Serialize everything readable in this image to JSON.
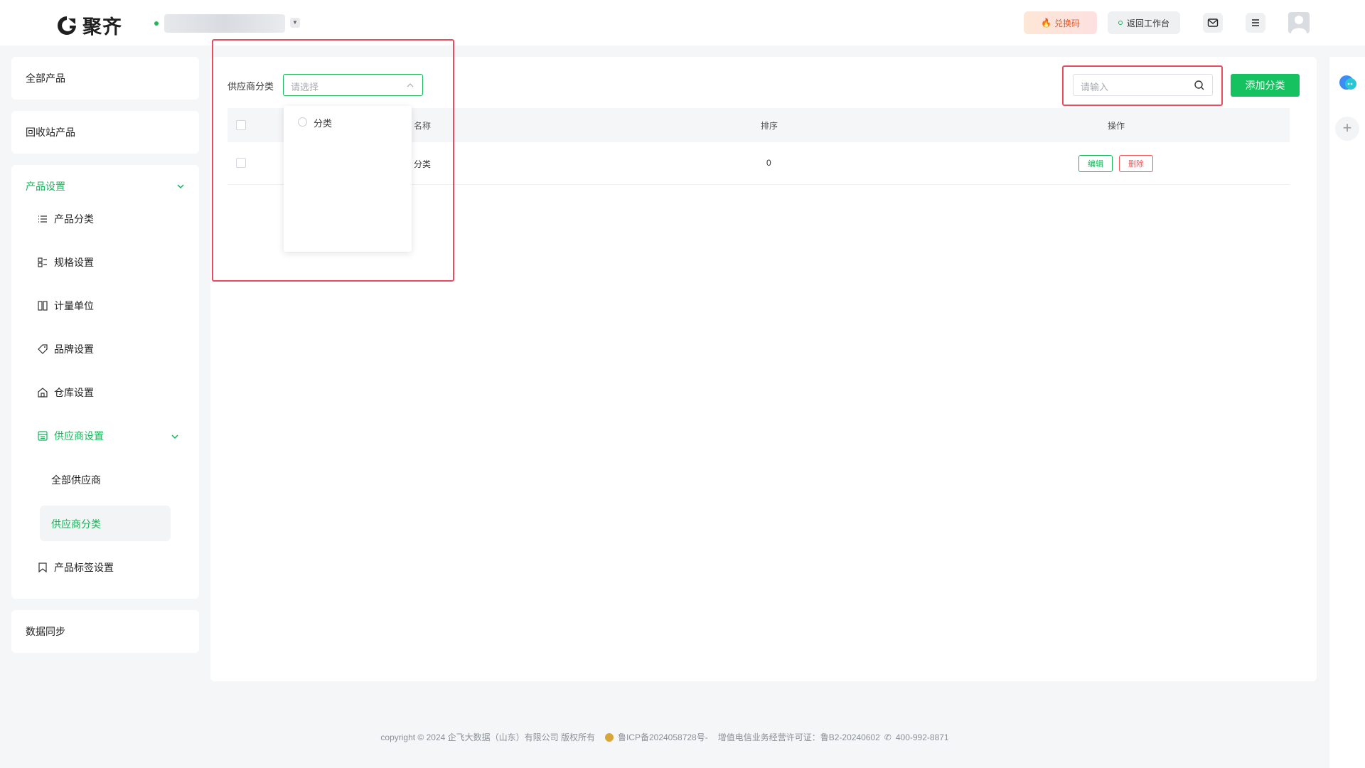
{
  "header": {
    "logo_text": "聚齐",
    "store_name": "",
    "redeem_label": "兑换码",
    "back_label": "返回工作台"
  },
  "sidebar": {
    "all_products": "全部产品",
    "recycle_products": "回收站产品",
    "product_settings": "产品设置",
    "items": [
      {
        "label": "产品分类",
        "icon": "list-icon"
      },
      {
        "label": "规格设置",
        "icon": "spec-icon"
      },
      {
        "label": "计量单位",
        "icon": "ruler-icon"
      },
      {
        "label": "品牌设置",
        "icon": "tag-icon"
      },
      {
        "label": "仓库设置",
        "icon": "warehouse-icon"
      },
      {
        "label": "供应商设置",
        "icon": "supplier-icon"
      },
      {
        "label": "产品标签设置",
        "icon": "bookmark-icon"
      }
    ],
    "supplier_sub": [
      "全部供应商",
      "供应商分类"
    ],
    "data_sync": "数据同步"
  },
  "filter": {
    "label": "供应商分类",
    "placeholder": "请选择",
    "options": [
      "分类"
    ]
  },
  "search": {
    "placeholder": "请输入"
  },
  "add_button": "添加分类",
  "table": {
    "columns": [
      "名称",
      "排序",
      "操作"
    ],
    "rows": [
      {
        "name": "分类",
        "sort": "0"
      }
    ],
    "edit_label": "编辑",
    "delete_label": "删除"
  },
  "footer": {
    "copyright": "copyright © 2024 企飞大数据（山东）有限公司 版权所有",
    "icp": "鲁ICP备2024058728号-",
    "license": "增值电信业务经营许可证：鲁B2-20240602",
    "phone": "400-992-8871"
  },
  "colors": {
    "accent": "#16c15f",
    "danger": "#f05a5a",
    "highlight": "#ec4a5f"
  }
}
